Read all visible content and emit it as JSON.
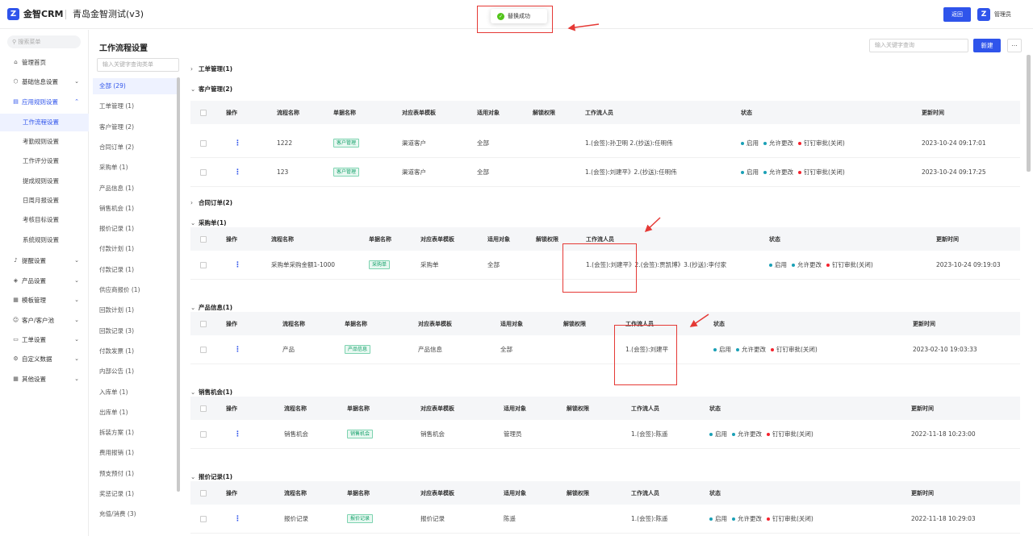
{
  "app": {
    "brand": "金智CRM",
    "company": "青岛金智测试(v3)",
    "back_label": "返回",
    "user_name": "管理员",
    "logo_glyph": "Z"
  },
  "toast": {
    "text": "替换成功"
  },
  "sidebar": {
    "search_placeholder": "搜索菜单",
    "items": [
      {
        "label": "管理首页",
        "icon": "home-icon"
      },
      {
        "label": "基础信息设置",
        "icon": "cube-icon"
      },
      {
        "label": "应用规则设置",
        "icon": "document-icon"
      },
      {
        "label": "提醒设置",
        "icon": "bell-icon"
      },
      {
        "label": "产品设置",
        "icon": "box-icon"
      },
      {
        "label": "模板管理",
        "icon": "template-icon"
      },
      {
        "label": "客户/客户池",
        "icon": "users-icon"
      },
      {
        "label": "工单设置",
        "icon": "ticket-icon"
      },
      {
        "label": "自定义数据",
        "icon": "custom-icon"
      },
      {
        "label": "其他设置",
        "icon": "grid-icon"
      }
    ],
    "sub_items": [
      "工作流程设置",
      "考勤规则设置",
      "工作评分设置",
      "提成规则设置",
      "日周月报设置",
      "考核目标设置",
      "系统规则设置"
    ]
  },
  "page": {
    "title": "工作流程设置",
    "search_placeholder": "输入关键字查询",
    "new_label": "新建",
    "more_label": "..."
  },
  "categories": {
    "search_placeholder": "输入关键字查询类单",
    "items": [
      "全部 (29)",
      "工单管理 (1)",
      "客户管理 (2)",
      "合同订单 (2)",
      "采购单 (1)",
      "产品信息 (1)",
      "销售机会 (1)",
      "报价记录 (1)",
      "付款计划 (1)",
      "付款记录 (1)",
      "供应商报价 (1)",
      "回款计划 (1)",
      "回款记录 (3)",
      "付款发票 (1)",
      "内部公告 (1)",
      "入库单 (1)",
      "出库单 (1)",
      "拆装方案 (1)",
      "费用报销 (1)",
      "预支预付 (1)",
      "奖惩记录 (1)",
      "充值/消费 (3)"
    ]
  },
  "columns": [
    "操作",
    "流程名称",
    "单据名称",
    "对应表单模板",
    "适用对象",
    "解锁权限",
    "工作流人员",
    "状态",
    "更新时间"
  ],
  "status_labels": [
    "启用",
    "允许更改",
    "钉钉审批(关闭)"
  ],
  "colors": {
    "accent": "#2f54eb",
    "status_blue": "#1aa0b6",
    "status_red": "#f5222d",
    "tag_green": "#14a06a"
  },
  "groups": [
    {
      "title": "工单管理(1)",
      "expanded": false,
      "rows": []
    },
    {
      "title": "客户管理(2)",
      "expanded": true,
      "rows": [
        {
          "name": "1222",
          "doc": "客户管理",
          "template": "渠道客户",
          "target": "全部",
          "unlock": "",
          "people": "1.(会签):孙卫明 2.(抄送):任明伟",
          "time": "2023-10-24 09:17:01"
        },
        {
          "name": "123",
          "doc": "客户管理",
          "template": "渠道客户",
          "target": "全部",
          "unlock": "",
          "people": "1.(会签):刘建平》2.(抄送):任明伟",
          "time": "2023-10-24 09:17:25"
        }
      ]
    },
    {
      "title": "合同订单(2)",
      "expanded": false,
      "rows": []
    },
    {
      "title": "采购单(1)",
      "expanded": true,
      "rows": [
        {
          "name": "采购单采购金额1-1000",
          "doc": "采购单",
          "template": "采购单",
          "target": "全部",
          "unlock": "",
          "people": "1.(会签):刘建平》2.(会签):贾凯博》3.(抄送):李付家",
          "time": "2023-10-24 09:19:03"
        }
      ]
    },
    {
      "title": "产品信息(1)",
      "expanded": true,
      "rows": [
        {
          "name": "产品",
          "doc": "产品信息",
          "template": "产品信息",
          "target": "全部",
          "unlock": "",
          "people": "1.(会签):刘建平",
          "time": "2023-02-10 19:03:33"
        }
      ]
    },
    {
      "title": "销售机会(1)",
      "expanded": true,
      "rows": [
        {
          "name": "销售机会",
          "doc": "销售机会",
          "template": "销售机会",
          "target": "管理员",
          "unlock": "",
          "people": "1.(会签):陈遥",
          "time": "2022-11-18 10:23:00"
        }
      ]
    },
    {
      "title": "报价记录(1)",
      "expanded": true,
      "rows": [
        {
          "name": "报价记录",
          "doc": "报价记录",
          "template": "报价记录",
          "target": "陈遥",
          "unlock": "",
          "people": "1.(会签):陈遥",
          "time": "2022-11-18 10:29:03"
        }
      ]
    }
  ]
}
